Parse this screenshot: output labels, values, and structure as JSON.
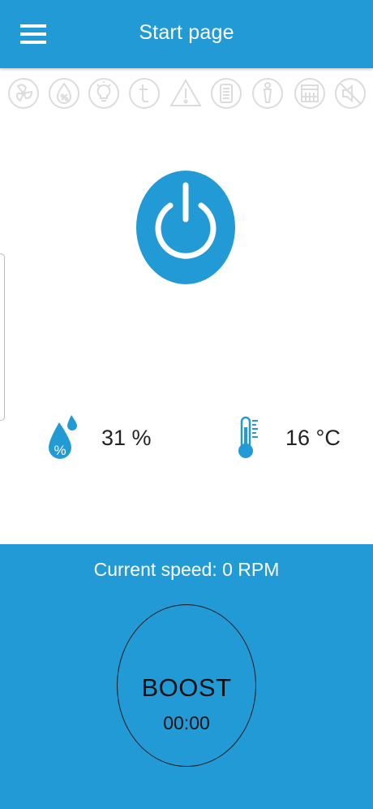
{
  "app_bar": {
    "title": "Start page",
    "menu_icon": "hamburger-menu-icon"
  },
  "status_icons": [
    {
      "name": "fan-status-icon"
    },
    {
      "name": "humidity-status-icon"
    },
    {
      "name": "light-status-icon"
    },
    {
      "name": "timer-status-icon"
    },
    {
      "name": "warning-status-icon"
    },
    {
      "name": "filter-status-icon"
    },
    {
      "name": "person-status-icon"
    },
    {
      "name": "calendar-status-icon"
    },
    {
      "name": "mute-status-icon"
    }
  ],
  "power": {
    "icon": "power-icon"
  },
  "readings": {
    "humidity": {
      "value": "31 %",
      "icon": "humidity-drop-icon"
    },
    "temperature": {
      "value": "16 °C",
      "icon": "thermometer-icon"
    }
  },
  "bottom": {
    "speed_text": "Current speed: 0 RPM",
    "boost_label": "BOOST",
    "boost_time": "00:00"
  },
  "colors": {
    "accent": "#229ad6",
    "icon_inactive": "#dcdcdc"
  }
}
